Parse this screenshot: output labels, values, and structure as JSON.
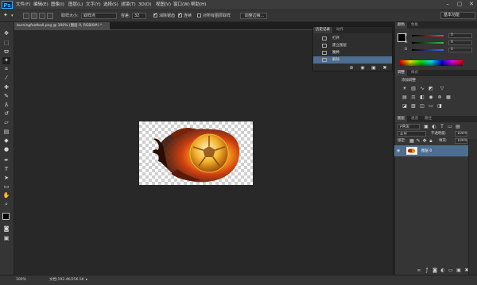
{
  "app": {
    "logo": "Ps",
    "menu": [
      "文件(F)",
      "编辑(E)",
      "图像(I)",
      "图层(L)",
      "文字(Y)",
      "选择(S)",
      "滤镜(T)",
      "3D(D)",
      "视图(V)",
      "窗口(W)",
      "帮助(H)"
    ],
    "window_controls": {
      "minimize": "–",
      "restore": "▢",
      "close": "✕"
    }
  },
  "options": {
    "tool_icon": "magic-wand-icon",
    "sample_size_label": "取样大小:",
    "sample_size_value": "取样点",
    "tolerance_label": "容差:",
    "tolerance_value": "32",
    "antialias_label": "消除锯齿",
    "antialias_checked": true,
    "contiguous_label": "连续",
    "contiguous_checked": true,
    "sample_all_layers_label": "对所有图层取样",
    "sample_all_layers_checked": false,
    "refine_edge_label": "调整边缘...",
    "workspace_label": "基本功能"
  },
  "document": {
    "tab_title": "burningfootball.png @ 100% (图层 0, RGB/8#) *",
    "zoom": "100%",
    "doc_info": "文档:192.4K/256.5K"
  },
  "history_panel": {
    "tabs": [
      "历史记录",
      "动作"
    ],
    "items": [
      {
        "label": "打开",
        "selected": false
      },
      {
        "label": "建立图层",
        "selected": false
      },
      {
        "label": "魔棒",
        "selected": false
      },
      {
        "label": "删除",
        "selected": true
      }
    ]
  },
  "color_panel": {
    "tabs": [
      "颜色",
      "色板"
    ],
    "channels": [
      {
        "label": "R",
        "value": "0",
        "color": "#ff3b3b"
      },
      {
        "label": "G",
        "value": "0",
        "color": "#35c235"
      },
      {
        "label": "B",
        "value": "0",
        "color": "#3b6bff"
      }
    ]
  },
  "adjustments_panel": {
    "tabs": [
      "调整",
      "样式"
    ],
    "title": "添加调整",
    "icons": [
      "brightness-contrast-icon",
      "levels-icon",
      "curves-icon",
      "exposure-icon",
      "vibrance-icon",
      "hue-saturation-icon",
      "color-balance-icon",
      "black-white-icon",
      "photo-filter-icon",
      "channel-mixer-icon",
      "color-lookup-icon",
      "invert-icon",
      "posterize-icon",
      "threshold-icon",
      "gradient-map-icon",
      "selective-color-icon"
    ]
  },
  "layers_panel": {
    "tabs": [
      "图层",
      "通道",
      "路径"
    ],
    "filter_label": "ρ类型",
    "blend_mode": "正常",
    "opacity_label": "不透明度:",
    "opacity_value": "100%",
    "lock_label": "锁定:",
    "fill_label": "填充:",
    "fill_value": "100%",
    "layers": [
      {
        "name": "图层 0",
        "visible": true,
        "selected": true
      }
    ]
  },
  "colors": {
    "accent_selected": "#4d6e91",
    "panel_bg": "#353535",
    "canvas_bg": "#282828"
  }
}
